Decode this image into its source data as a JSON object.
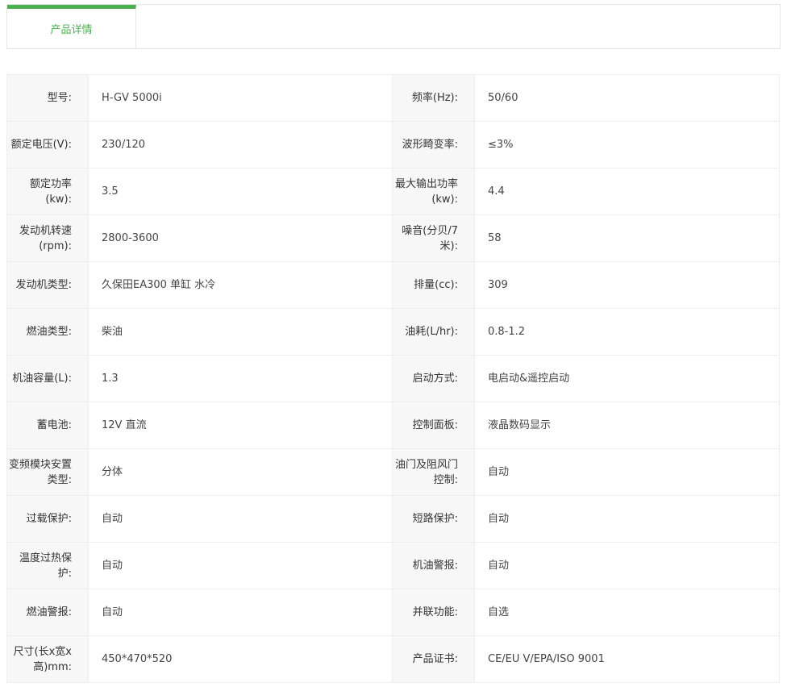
{
  "tabs": [
    {
      "label": "产品详情",
      "active": true,
      "accent_color": "#4caf50"
    }
  ],
  "specs": {
    "rows": [
      [
        {
          "label": "型号:",
          "value": "H-GV 5000i"
        },
        {
          "label": "频率(Hz):",
          "value": "50/60"
        }
      ],
      [
        {
          "label": "额定电压(V):",
          "value": "230/120"
        },
        {
          "label": "波形畸变率:",
          "value": "≤3%"
        }
      ],
      [
        {
          "label": "额定功率(kw):",
          "value": "3.5"
        },
        {
          "label": "最大输出功率(kw):",
          "value": "4.4"
        }
      ],
      [
        {
          "label": "发动机转速(rpm):",
          "value": "2800-3600"
        },
        {
          "label": "噪音(分贝/7米):",
          "value": "58"
        }
      ],
      [
        {
          "label": "发动机类型:",
          "value": "久保田EA300 单缸 水冷"
        },
        {
          "label": "排量(cc):",
          "value": "309"
        }
      ],
      [
        {
          "label": "燃油类型:",
          "value": "柴油"
        },
        {
          "label": "油耗(L/hr):",
          "value": "0.8-1.2"
        }
      ],
      [
        {
          "label": "机油容量(L):",
          "value": "1.3"
        },
        {
          "label": "启动方式:",
          "value": "电启动&遥控启动"
        }
      ],
      [
        {
          "label": "蓄电池:",
          "value": "12V 直流"
        },
        {
          "label": "控制面板:",
          "value": "液晶数码显示"
        }
      ],
      [
        {
          "label": "变频模块安置类型:",
          "value": "分体"
        },
        {
          "label": "油门及阻风门控制:",
          "value": "自动"
        }
      ],
      [
        {
          "label": "过载保护:",
          "value": "自动"
        },
        {
          "label": "短路保护:",
          "value": "自动"
        }
      ],
      [
        {
          "label": "温度过热保护:",
          "value": "自动"
        },
        {
          "label": "机油警报:",
          "value": "自动"
        }
      ],
      [
        {
          "label": "燃油警报:",
          "value": "自动"
        },
        {
          "label": "并联功能:",
          "value": "自选"
        }
      ],
      [
        {
          "label": "尺寸(长x宽x高)mm:",
          "value": "450*470*520"
        },
        {
          "label": "产品证书:",
          "value": "CE/EU V/EPA/ISO 9001"
        }
      ]
    ]
  }
}
